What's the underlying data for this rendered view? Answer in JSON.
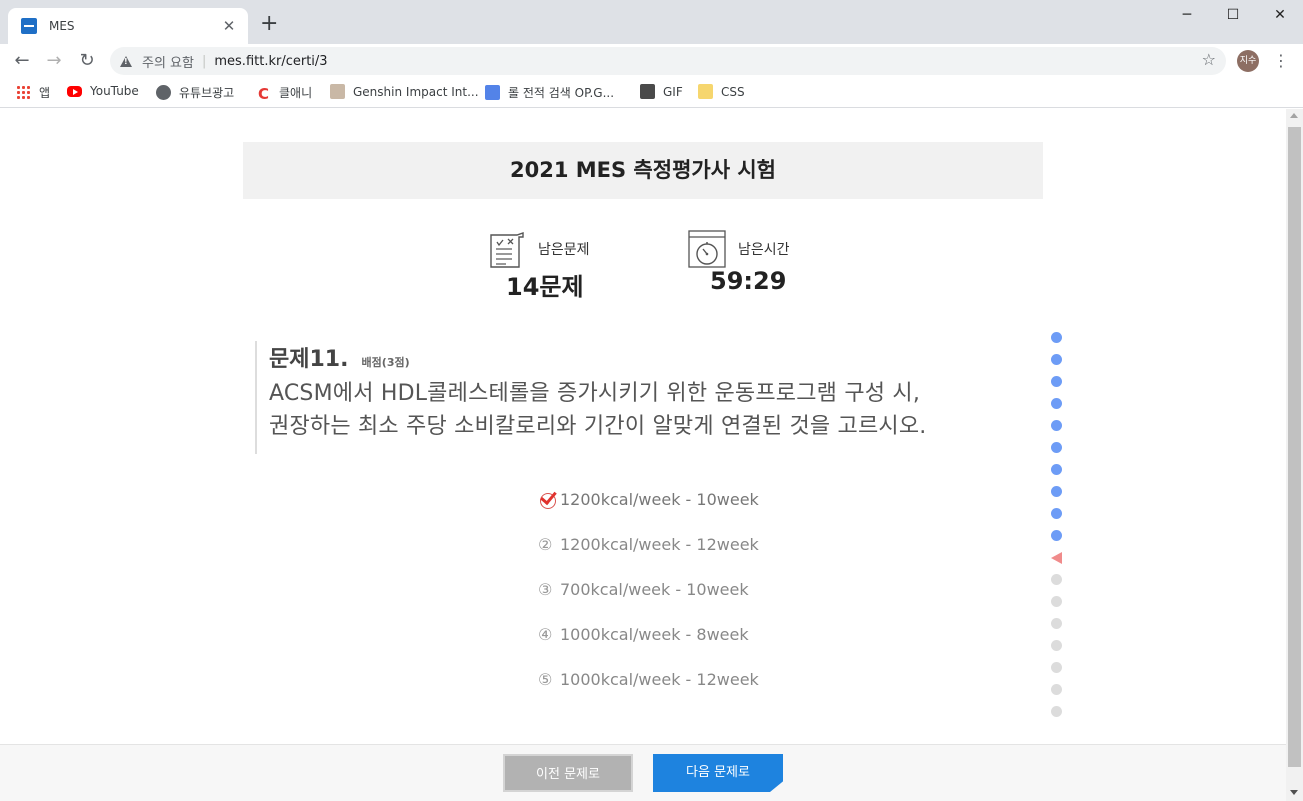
{
  "browser": {
    "tab_title": "MES",
    "omnibox": {
      "warning": "주의 요함",
      "url": "mes.fitt.kr/certi/3"
    },
    "profile_initials": "지수",
    "bookmarks": [
      {
        "label": "앱",
        "icon": "apps-grid-icon"
      },
      {
        "label": "YouTube",
        "icon": "youtube-icon"
      },
      {
        "label": "유튜브광고",
        "icon": "globe-icon"
      },
      {
        "label": "클애니",
        "icon": "c-logo-icon"
      },
      {
        "label": "Genshin Impact Int...",
        "icon": "genshin-icon"
      },
      {
        "label": "롤 전적 검색 OP.G...",
        "icon": "opgg-icon"
      },
      {
        "label": "GIF",
        "icon": "gif-icon"
      },
      {
        "label": "CSS",
        "icon": "folder-icon"
      }
    ]
  },
  "exam": {
    "title": "2021 MES 측정평가사 시험",
    "remaining_questions": {
      "label": "남은문제",
      "value": "14문제"
    },
    "remaining_time": {
      "label": "남은시간",
      "value": "59:29"
    }
  },
  "question": {
    "number": "문제11.",
    "score": "배점(3점)",
    "line1": "ACSM에서 HDL콜레스테롤을 증가시키기 위한 운동프로그램 구성 시,",
    "line2": "권장하는 최소 주당 소비칼로리와 기간이 알맞게 연결된 것을 고르시오."
  },
  "options": [
    {
      "num": "①",
      "text": "1200kcal/week - 10week",
      "selected": true
    },
    {
      "num": "②",
      "text": "1200kcal/week - 12week",
      "selected": false
    },
    {
      "num": "③",
      "text": "700kcal/week - 10week",
      "selected": false
    },
    {
      "num": "④",
      "text": "1000kcal/week - 8week",
      "selected": false
    },
    {
      "num": "⑤",
      "text": "1000kcal/week - 12week",
      "selected": false
    }
  ],
  "progress": {
    "total": 18,
    "answered": 10,
    "current": 11,
    "colors": {
      "answered": "#6d9cf6",
      "current": "#f08b8b",
      "unanswered": "#dcdcdc"
    }
  },
  "buttons": {
    "prev": "이전 문제로",
    "next": "다음 문제로"
  }
}
